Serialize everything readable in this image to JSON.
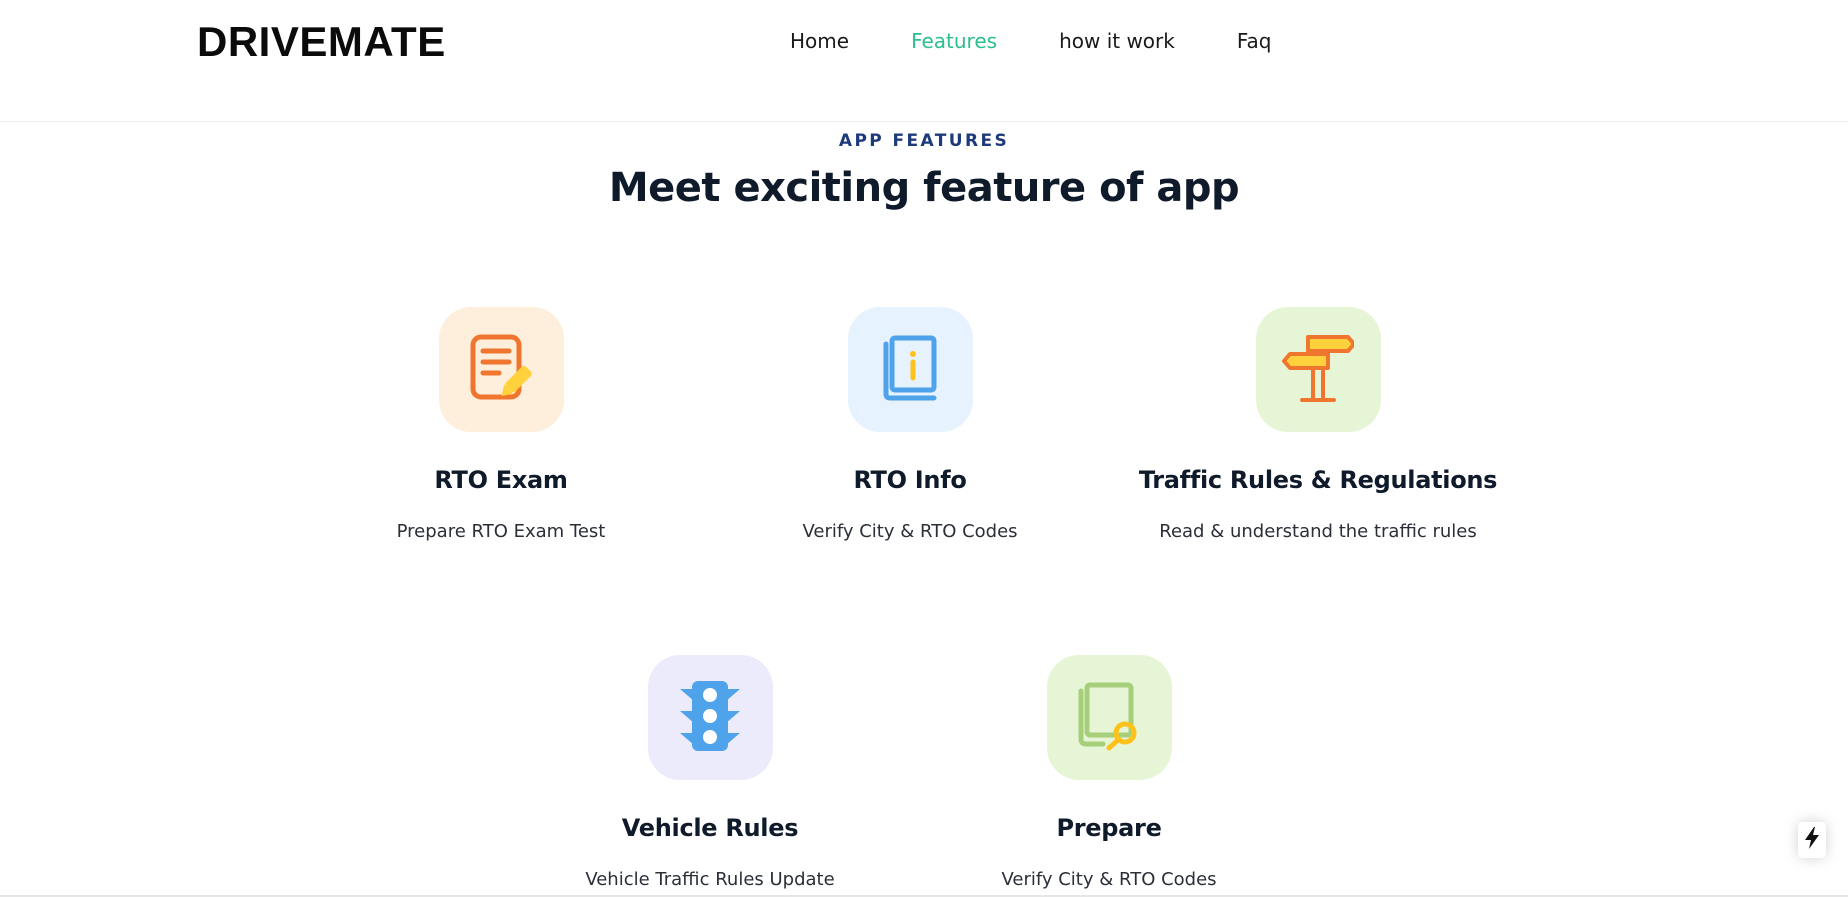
{
  "header": {
    "logo": "DRIVEMATE",
    "nav": [
      {
        "label": "Home",
        "active": false
      },
      {
        "label": "Features",
        "active": true
      },
      {
        "label": "how it work",
        "active": false
      },
      {
        "label": "Faq",
        "active": false
      }
    ]
  },
  "section": {
    "eyebrow": "APP FEATURES",
    "title": "Meet exciting feature of app"
  },
  "features": [
    {
      "title": "RTO Exam",
      "description": "Prepare RTO Exam Test",
      "icon": "exam-document-icon",
      "bg": "#fdefdc"
    },
    {
      "title": "RTO Info",
      "description": "Verify City & RTO Codes",
      "icon": "info-book-icon",
      "bg": "#e6f2fd"
    },
    {
      "title": "Traffic Rules & Regulations",
      "description": "Read & understand the traffic rules",
      "icon": "signpost-icon",
      "bg": "#e6f5d6"
    },
    {
      "title": "Vehicle Rules",
      "description": "Vehicle Traffic Rules Update",
      "icon": "traffic-light-icon",
      "bg": "#ecebfb"
    },
    {
      "title": "Prepare",
      "description": "Verify City & RTO Codes",
      "icon": "book-search-icon",
      "bg": "#e6f5d6"
    }
  ],
  "floating_button": {
    "icon": "lightning-bolt-icon"
  },
  "colors": {
    "accent": "#2bbf8e",
    "eyebrow": "#1d3a7a",
    "heading": "#0f1a2b"
  }
}
